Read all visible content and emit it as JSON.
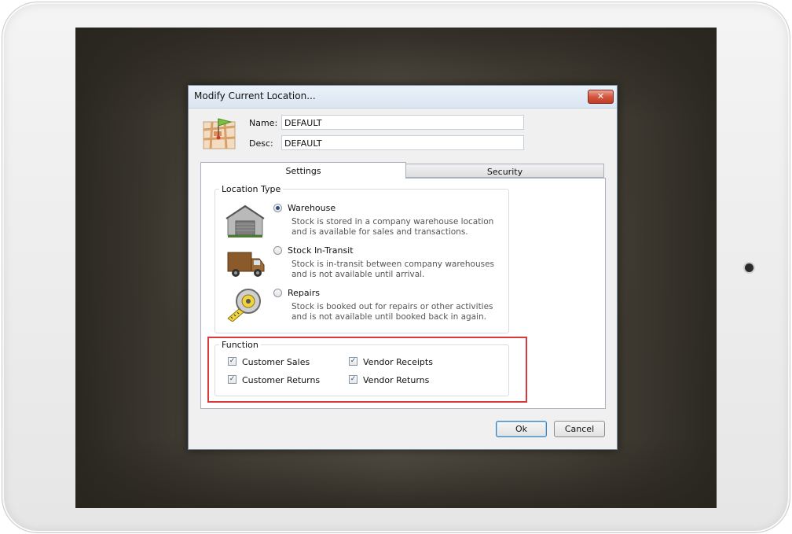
{
  "dialog": {
    "title": "Modify Current Location...",
    "close_glyph": "✕"
  },
  "fields": {
    "name_label": "Name:",
    "name_value": "DEFAULT",
    "desc_label": "Desc:",
    "desc_value": "DEFAULT"
  },
  "tabs": [
    {
      "label": "Settings",
      "active": true
    },
    {
      "label": "Security",
      "active": false
    }
  ],
  "location_type": {
    "legend": "Location Type",
    "options": [
      {
        "label": "Warehouse",
        "checked": true,
        "icon": "warehouse-icon",
        "desc_line1": "Stock is stored in a company warehouse location",
        "desc_line2": "and is available for sales and transactions."
      },
      {
        "label": "Stock In-Transit",
        "checked": false,
        "icon": "delivery-truck-icon",
        "desc_line1": "Stock is in-transit between company warehouses",
        "desc_line2": "and is not available until arrival."
      },
      {
        "label": "Repairs",
        "checked": false,
        "icon": "tape-measure-icon",
        "desc_line1": "Stock is booked out for repairs or other activities",
        "desc_line2": "and is not available until booked back in again."
      }
    ]
  },
  "function": {
    "legend": "Function",
    "checkboxes": [
      {
        "label": "Customer Sales",
        "checked": true
      },
      {
        "label": "Vendor Receipts",
        "checked": true
      },
      {
        "label": "Customer Returns",
        "checked": true
      },
      {
        "label": "Vendor Returns",
        "checked": true
      }
    ],
    "check_glyph": "✓"
  },
  "buttons": {
    "ok": "Ok",
    "cancel": "Cancel"
  },
  "colors": {
    "highlight": "#d9393b",
    "close_button": "#c03d28",
    "default_button_border": "#3c7fb1"
  }
}
